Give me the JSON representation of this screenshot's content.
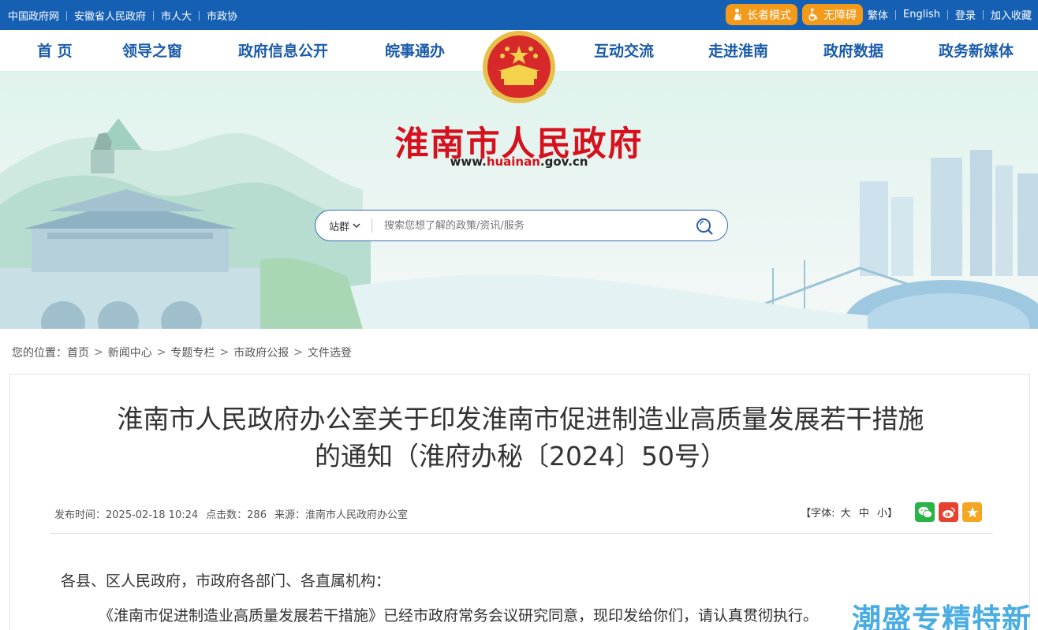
{
  "topbar": {
    "links": [
      "中国政府网",
      "安徽省人民政府",
      "市人大",
      "市政协"
    ],
    "elder_mode": "长者模式",
    "accessibility": "无障碍",
    "traditional": "繁体",
    "english": "English",
    "login": "登录",
    "favorite": "加入收藏"
  },
  "nav": {
    "left": [
      "首 页",
      "领导之窗",
      "政府信息公开",
      "皖事通办"
    ],
    "right": [
      "互动交流",
      "走进淮南",
      "政府数据",
      "政务新媒体"
    ]
  },
  "brand": {
    "title": "淮南市人民政府",
    "url_prefix": "www.",
    "url_main": "huainan",
    "url_suffix": ".gov.cn"
  },
  "search": {
    "scope": "站群",
    "placeholder": "搜索您想了解的政策/资讯/服务"
  },
  "breadcrumb": {
    "label": "您的位置：",
    "items": [
      "首页",
      "新闻中心",
      "专题专栏",
      "市政府公报",
      "文件选登"
    ]
  },
  "article": {
    "title_line1": "淮南市人民政府办公室关于印发淮南市促进制造业高质量发展若干措施",
    "title_line2": "的通知（淮府办秘〔2024〕50号）",
    "publish_time": "发布时间：2025-02-18 10:24",
    "hits": "点击数：286",
    "source": "来源：淮南市人民政府办公室",
    "font_label": "【字体:",
    "font_large": "大",
    "font_medium": "中",
    "font_small": "小】",
    "para1": "各县、区人民政府，市政府各部门、各直属机构：",
    "para2": "《淮南市促进制造业高质量发展若干措施》已经市政府常务会议研究同意，现印发给你们，请认真贯彻执行。"
  },
  "watermark": "潮盛专精特新",
  "colors": {
    "topbar": "#1660b4",
    "nav_text": "#1a5ba8",
    "brand_red": "#d6101c",
    "pill_orange": "#f39a1a",
    "wechat": "#2ab346",
    "weibo": "#e8412f",
    "favorite_star": "#f5a623"
  }
}
